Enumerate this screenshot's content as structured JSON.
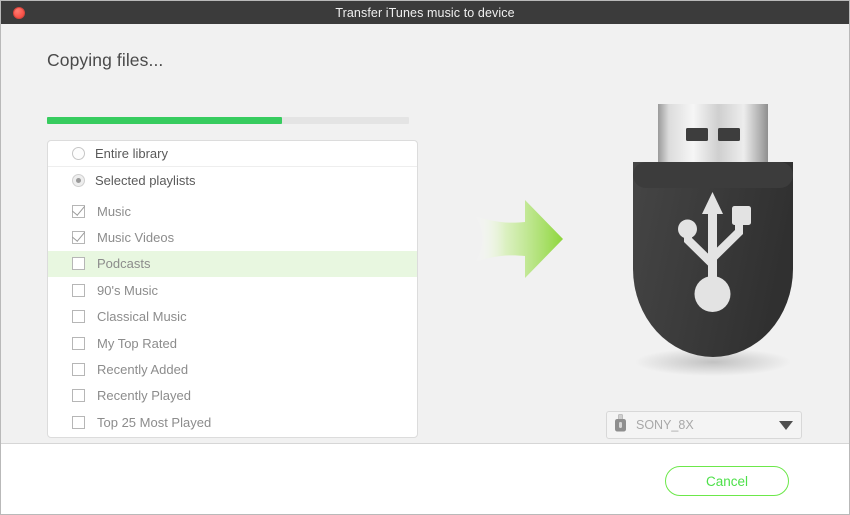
{
  "window": {
    "title": "Transfer iTunes music to device",
    "close_icon": "close-icon"
  },
  "main": {
    "heading": "Copying files...",
    "progress": {
      "percent": 65,
      "fill_color": "#37cc5f",
      "track_color": "#e4e4e4"
    },
    "source_options": [
      {
        "label": "Entire library",
        "selected": false
      },
      {
        "label": "Selected playlists",
        "selected": true
      }
    ],
    "playlists": [
      {
        "label": "Music",
        "checked": true,
        "highlighted": false
      },
      {
        "label": "Music Videos",
        "checked": true,
        "highlighted": false
      },
      {
        "label": "Podcasts",
        "checked": false,
        "highlighted": true
      },
      {
        "label": "90's Music",
        "checked": false,
        "highlighted": false
      },
      {
        "label": "Classical Music",
        "checked": false,
        "highlighted": false
      },
      {
        "label": "My Top Rated",
        "checked": false,
        "highlighted": false
      },
      {
        "label": "Recently Added",
        "checked": false,
        "highlighted": false
      },
      {
        "label": "Recently Played",
        "checked": false,
        "highlighted": false
      },
      {
        "label": "Top 25 Most Played",
        "checked": false,
        "highlighted": false
      }
    ],
    "transfer_arrow_icon": "green-right-arrow-icon",
    "device_illustration_icon": "usb-flash-drive-icon"
  },
  "device_select": {
    "icon": "usb-drive-icon",
    "value": "SONY_8X",
    "caret_icon": "chevron-down-icon"
  },
  "footer": {
    "cancel_label": "Cancel",
    "accent_color": "#5ee04a"
  }
}
